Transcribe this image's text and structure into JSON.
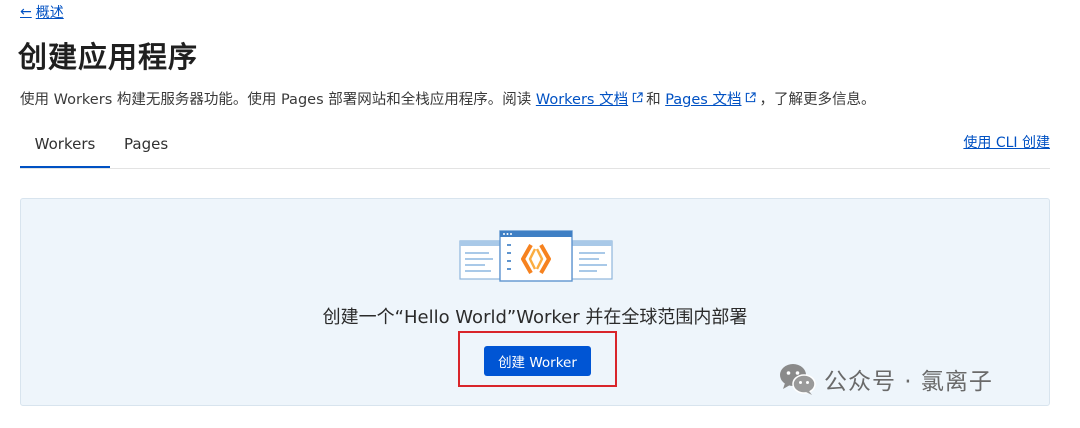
{
  "back_link": {
    "arrow": "←",
    "label": "概述"
  },
  "page_title": "创建应用程序",
  "description": {
    "text_1": "使用 Workers 构建无服务器功能。使用 Pages 部署网站和全栈应用程序。阅读 ",
    "workers_docs_link": "Workers 文档",
    "text_2": "和 ",
    "pages_docs_link": "Pages 文档",
    "text_3": "，了解更多信息。"
  },
  "tabs": [
    {
      "label": "Workers",
      "active": true
    },
    {
      "label": "Pages",
      "active": false
    }
  ],
  "cli_link": "使用 CLI 创建",
  "empty_state": {
    "headline": "创建一个“Hello World”Worker 并在全球范围内部署",
    "button_label": "创建 Worker"
  },
  "watermark": {
    "text": "公众号 · 氯离子"
  },
  "colors": {
    "link": "#0051c3",
    "primary_button": "#0055d4",
    "card_background": "#eef5fb",
    "highlight_border": "#d9252a",
    "accent_orange": "#f6821f"
  },
  "icons": {
    "back": "arrow-left-icon",
    "external": "external-link-icon",
    "illustration": "workers-windows-illustration",
    "watermark": "wechat-logo-icon"
  }
}
